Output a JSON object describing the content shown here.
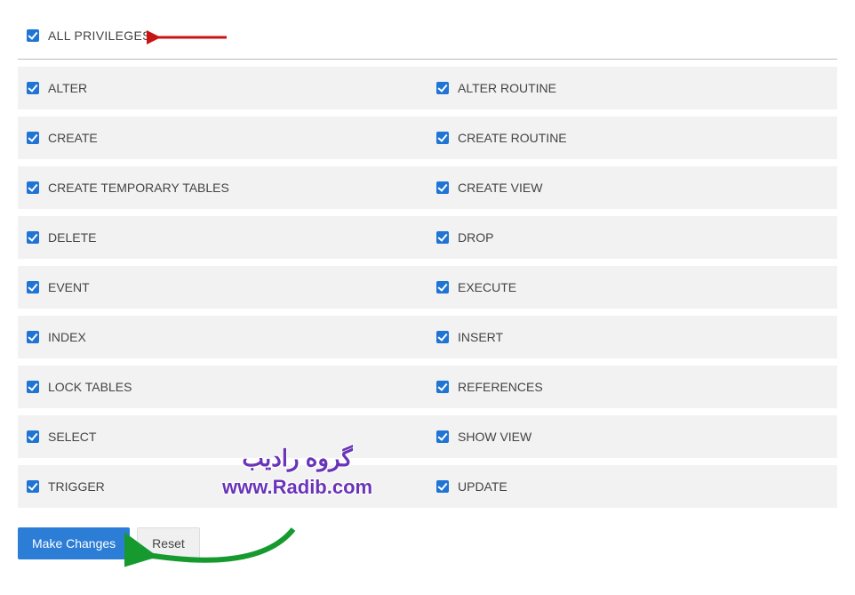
{
  "allPrivileges": {
    "label": "ALL PRIVILEGES",
    "checked": true
  },
  "privileges": [
    {
      "left": {
        "label": "ALTER",
        "checked": true
      },
      "right": {
        "label": "ALTER ROUTINE",
        "checked": true
      }
    },
    {
      "left": {
        "label": "CREATE",
        "checked": true
      },
      "right": {
        "label": "CREATE ROUTINE",
        "checked": true
      }
    },
    {
      "left": {
        "label": "CREATE TEMPORARY TABLES",
        "checked": true
      },
      "right": {
        "label": "CREATE VIEW",
        "checked": true
      }
    },
    {
      "left": {
        "label": "DELETE",
        "checked": true
      },
      "right": {
        "label": "DROP",
        "checked": true
      }
    },
    {
      "left": {
        "label": "EVENT",
        "checked": true
      },
      "right": {
        "label": "EXECUTE",
        "checked": true
      }
    },
    {
      "left": {
        "label": "INDEX",
        "checked": true
      },
      "right": {
        "label": "INSERT",
        "checked": true
      }
    },
    {
      "left": {
        "label": "LOCK TABLES",
        "checked": true
      },
      "right": {
        "label": "REFERENCES",
        "checked": true
      }
    },
    {
      "left": {
        "label": "SELECT",
        "checked": true
      },
      "right": {
        "label": "SHOW VIEW",
        "checked": true
      }
    },
    {
      "left": {
        "label": "TRIGGER",
        "checked": true
      },
      "right": {
        "label": "UPDATE",
        "checked": true
      }
    }
  ],
  "buttons": {
    "primary": "Make Changes",
    "secondary": "Reset"
  },
  "watermark": {
    "fa": "گروه رادیب",
    "url": "www.Radib.com"
  }
}
